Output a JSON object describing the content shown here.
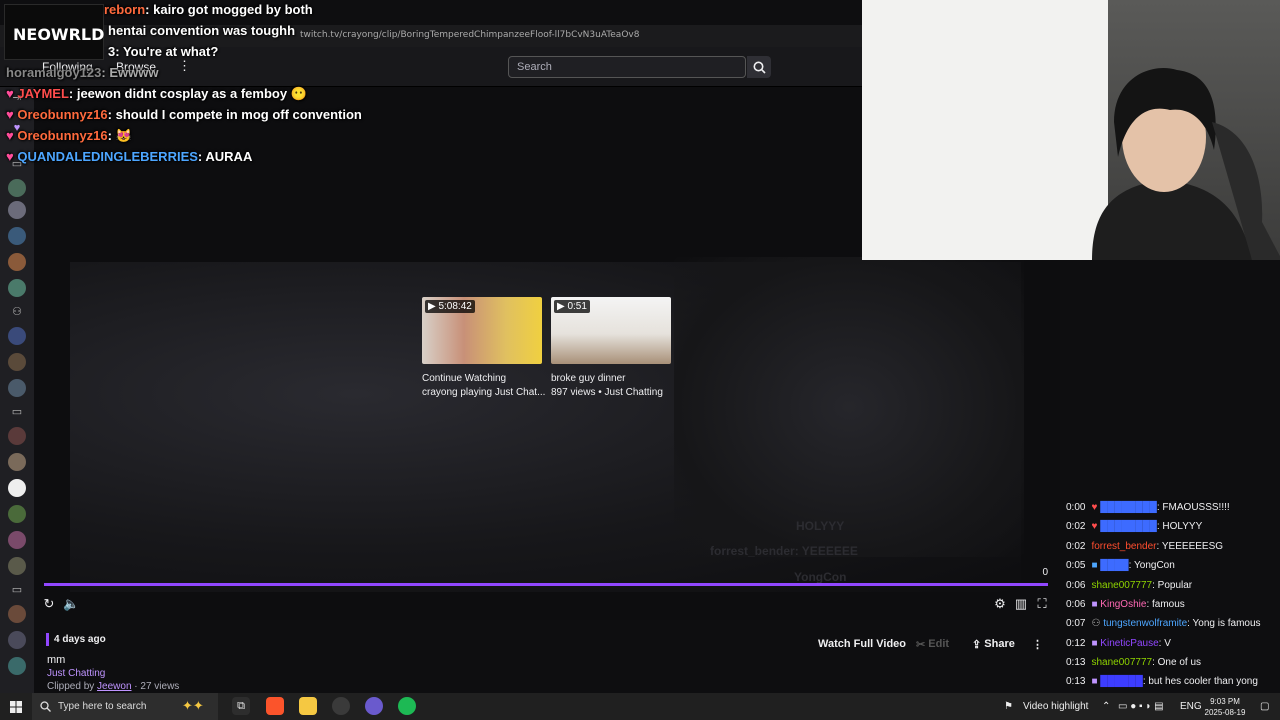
{
  "browser": {
    "url": "twitch.tv/crayong/clip/BoringTemperedChimpanzeeFloof-ll7bCvN3uATeaOv8"
  },
  "nav": {
    "following": "Following",
    "browse": "Browse",
    "more": "⋮",
    "search_placeholder": "Search"
  },
  "overlay": {
    "logo": "NEOWRLD",
    "chat": [
      {
        "user": "reborn",
        "msg": "kairo got mogged by both",
        "color": "#ff6a3d"
      },
      {
        "user": "",
        "msg": "hentai convention was toughh",
        "color": "#ffffff"
      },
      {
        "user": "3",
        "msg": "You're at what?",
        "color": "#ffffff"
      },
      {
        "user": "horamalgoy123",
        "msg": "Ewwww",
        "color": "#a0a0a0"
      },
      {
        "user": "JAYMEL",
        "msg": "jeewon didnt cosplay as a femboy 😶",
        "color": "#ff4d4d"
      },
      {
        "user": "Oreobunnyz16",
        "msg": "should I compete in mog off convention",
        "color": "#ff6a3d"
      },
      {
        "user": "Oreobunnyz16",
        "msg": "😻",
        "color": "#ff6a3d"
      },
      {
        "user": "QUANDALEDINGLEBERRIES",
        "msg": "AURAA",
        "color": "#4da6ff"
      }
    ]
  },
  "player": {
    "ghost": [
      "HOLYYY",
      "forrest_bender: YEEEEEE",
      "YongCon"
    ],
    "recs": [
      {
        "duration": "5:08:42",
        "title": "Continue Watching",
        "sub": "crayong playing Just Chat..."
      },
      {
        "duration": "0:51",
        "title": "broke guy dinner",
        "sub": "897 views • Just Chatting"
      }
    ],
    "progress_label": "0",
    "progress_fraction": 1.0
  },
  "clip": {
    "ago": "4 days ago",
    "title": "mm",
    "category": "Just Chatting",
    "clipped_by_prefix": "Clipped by",
    "clipper": "Jeewon",
    "views": "· 27 views",
    "watch_full": "Watch Full Video",
    "edit": "Edit",
    "share": "Share",
    "more": "⋮"
  },
  "chat": [
    {
      "time": "0:00",
      "user": "",
      "msg": ": FMAOUSSS!!!!",
      "color": "#3d6bff"
    },
    {
      "time": "0:02",
      "user": "",
      "msg": ": HOLYYY",
      "color": "#3d6bff"
    },
    {
      "time": "0:02",
      "user": "forrest_bender",
      "msg": ": YEEEEEESG",
      "color": "#ff4d2e"
    },
    {
      "time": "0:05",
      "user": "",
      "msg": ": YongCon",
      "color": "#3d6bff"
    },
    {
      "time": "0:06",
      "user": "shane007777",
      "msg": ": Popular",
      "color": "#8fd400"
    },
    {
      "time": "0:06",
      "user": "KingOshie",
      "msg": ": famous",
      "color": "#ff69b4"
    },
    {
      "time": "0:07",
      "user": "tungstenwolframite",
      "msg": ": Yong is famous",
      "color": "#4da6ff"
    },
    {
      "time": "0:12",
      "user": "KineticPause",
      "msg": ": V",
      "color": "#9147ff"
    },
    {
      "time": "0:13",
      "user": "shane007777",
      "msg": ": One of us",
      "color": "#8fd400"
    },
    {
      "time": "0:13",
      "user": "",
      "msg": ": but hes cooler than yong",
      "color": "#3d3dff"
    }
  ],
  "taskbar": {
    "search": "Type here to search",
    "video_highlight": "Video highlight",
    "lang": "ENG",
    "time": "9:03 PM",
    "date": "2025-08-19"
  },
  "colors": {
    "accent": "#9147ff",
    "bg": "#0e0e10",
    "link": "#bf94ff"
  }
}
